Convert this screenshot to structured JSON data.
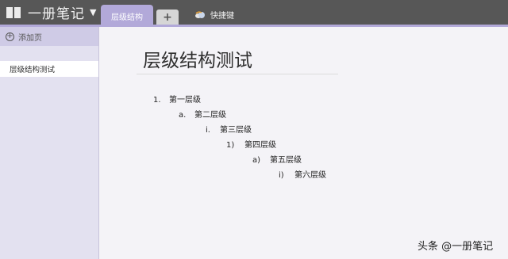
{
  "notebook": {
    "title": "一册笔记"
  },
  "tabs": [
    {
      "label": "层级结构"
    },
    {
      "label": "+"
    },
    {
      "label": "快捷键"
    }
  ],
  "sidebar": {
    "add_page_label": "添加页",
    "pages": [
      {
        "label": "层级结构测试"
      }
    ]
  },
  "page": {
    "title": "层级结构测试",
    "list": [
      {
        "marker": "1.",
        "text": "第一层级"
      },
      {
        "marker": "a.",
        "text": "第二层级"
      },
      {
        "marker": "i.",
        "text": "第三层级"
      },
      {
        "marker": "1)",
        "text": "第四层级"
      },
      {
        "marker": "a)",
        "text": "第五层级"
      },
      {
        "marker": "i)",
        "text": "第六层级"
      }
    ]
  },
  "watermark": "头条 @一册笔记",
  "colors": {
    "topbar": "#575757",
    "accent": "#b2a9d9",
    "sidebar": "#e3e1f0",
    "canvas": "#f4f3f7"
  }
}
